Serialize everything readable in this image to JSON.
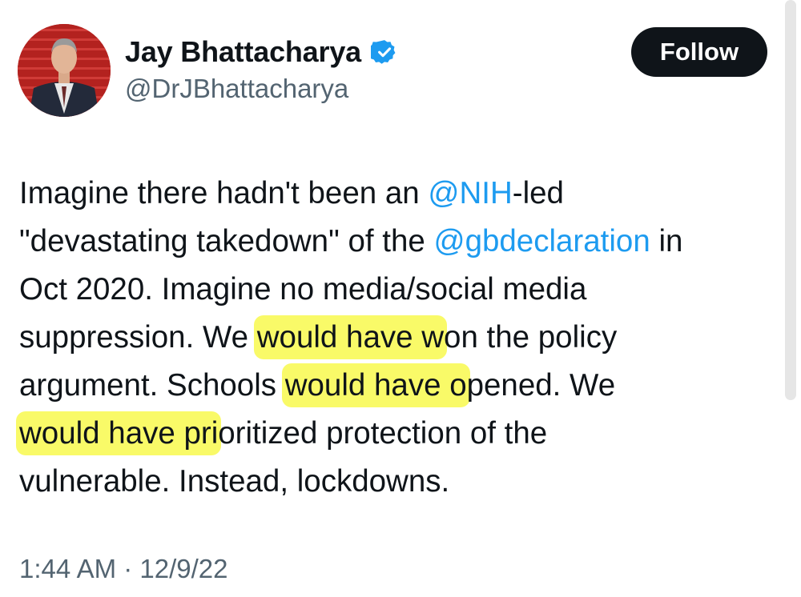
{
  "author": {
    "display_name": "Jay Bhattacharya",
    "handle": "@DrJBhattacharya",
    "verified": true,
    "verified_badge_color": "#1d9bf0"
  },
  "follow_button": {
    "label": "Follow"
  },
  "tweet": {
    "lines": [
      [
        {
          "text": "Imagine there hadn't been an "
        },
        {
          "text": "@NIH",
          "mention": true
        },
        {
          "text": "-led"
        }
      ],
      [
        {
          "text": "\"devastating takedown\" of the "
        },
        {
          "text": "@gbdeclaration",
          "mention": true
        },
        {
          "text": " in"
        }
      ],
      [
        {
          "text": "Oct 2020. Imagine no media/social media"
        }
      ],
      [
        {
          "text": "suppression. We "
        },
        {
          "text": "would have w",
          "highlight": true
        },
        {
          "text": "on the policy"
        }
      ],
      [
        {
          "text": "argument. Schools "
        },
        {
          "text": "would have o",
          "highlight": true
        },
        {
          "text": "pened. We"
        }
      ],
      [
        {
          "text": "would have pri",
          "highlight": true
        },
        {
          "text": "oritized protection of the"
        }
      ],
      [
        {
          "text": "vulnerable. Instead, lockdowns."
        }
      ]
    ],
    "timestamp": "1:44 AM · 12/9/22"
  },
  "colors": {
    "text": "#0f1419",
    "secondary_text": "#536471",
    "mention": "#1d9bf0",
    "highlight": "#f6f828",
    "button_bg": "#0f1419"
  }
}
